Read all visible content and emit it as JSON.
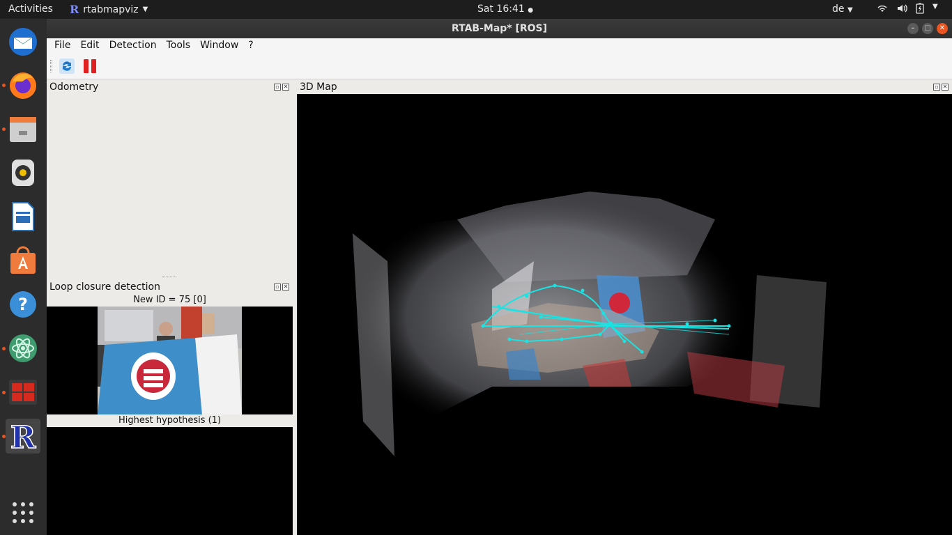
{
  "topbar": {
    "activities": "Activities",
    "app_name": "rtabmapviz",
    "app_logo": "R",
    "clock": "Sat 16:41",
    "keyboard_layout": "de",
    "tray_icons": [
      "wifi-icon",
      "volume-icon",
      "battery-icon",
      "power-menu-icon"
    ]
  },
  "dock": {
    "items": [
      "thunderbird-icon",
      "firefox-icon",
      "files-icon",
      "rhythmbox-icon",
      "libreoffice-writer-icon",
      "software-center-icon",
      "help-icon",
      "atom-icon",
      "terminal-app-icon",
      "rtabmap-icon",
      "show-apps-icon"
    ]
  },
  "window": {
    "title": "RTAB-Map* [ROS]",
    "menu": [
      "File",
      "Edit",
      "Detection",
      "Tools",
      "Window",
      "?"
    ],
    "toolbar": [
      "refresh-icon",
      "pause-icon"
    ]
  },
  "odometry": {
    "title": "Odometry"
  },
  "loop": {
    "title": "Loop closure detection",
    "new_id": "New ID = 75 [0]",
    "highest": "Highest hypothesis (1)",
    "robot_text": "≡"
  },
  "map3d": {
    "title": "3D Map"
  },
  "colors": {
    "accent": "#e95420",
    "graph": "#19e3e3",
    "topbar": "#1d1d1d",
    "dock": "#2c2c2c",
    "panel": "#edebe8"
  }
}
